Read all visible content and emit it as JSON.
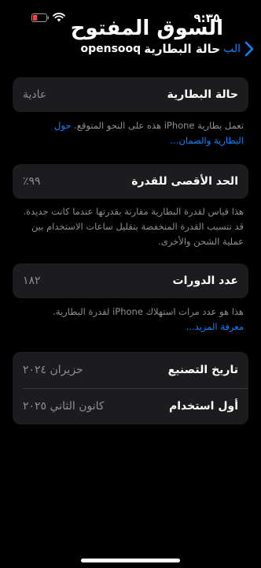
{
  "status_bar": {
    "time": "٩:٣٥"
  },
  "watermark": "السوق المفتوح",
  "nav": {
    "brand": "opensooq",
    "title": "حالة البطارية",
    "back": "الب"
  },
  "battery_health": {
    "label": "حالة البطارية",
    "value": "عادية",
    "note": "تعمل بطارية iPhone هذه على النحو المتوقع.",
    "note_link": "حول البطارية والضمان..."
  },
  "max_capacity": {
    "label": "الحد الأقصى للقدرة",
    "value": "٪٩٩",
    "note": "هذا قياس لقدرة البطارية مقارنة بقدرتها عندما كانت جديدة. قد تتسبب القدرة المنخفضة بتقليل ساعات الاستخدام بين عملية الشحن والأخرى."
  },
  "cycle_count": {
    "label": "عدد الدورات",
    "value": "١٨٢",
    "note": "هذا هو عدد مرات استهلاك iPhone لقدرة البطارية.",
    "note_link": "معرفة المزيد..."
  },
  "info": {
    "manufacture_label": "تاريخ التصنيع",
    "manufacture_value": "حزيران ٢٠٢٤",
    "first_use_label": "أول استخدام",
    "first_use_value": "كانون الثاني ٢٠٢٥"
  }
}
